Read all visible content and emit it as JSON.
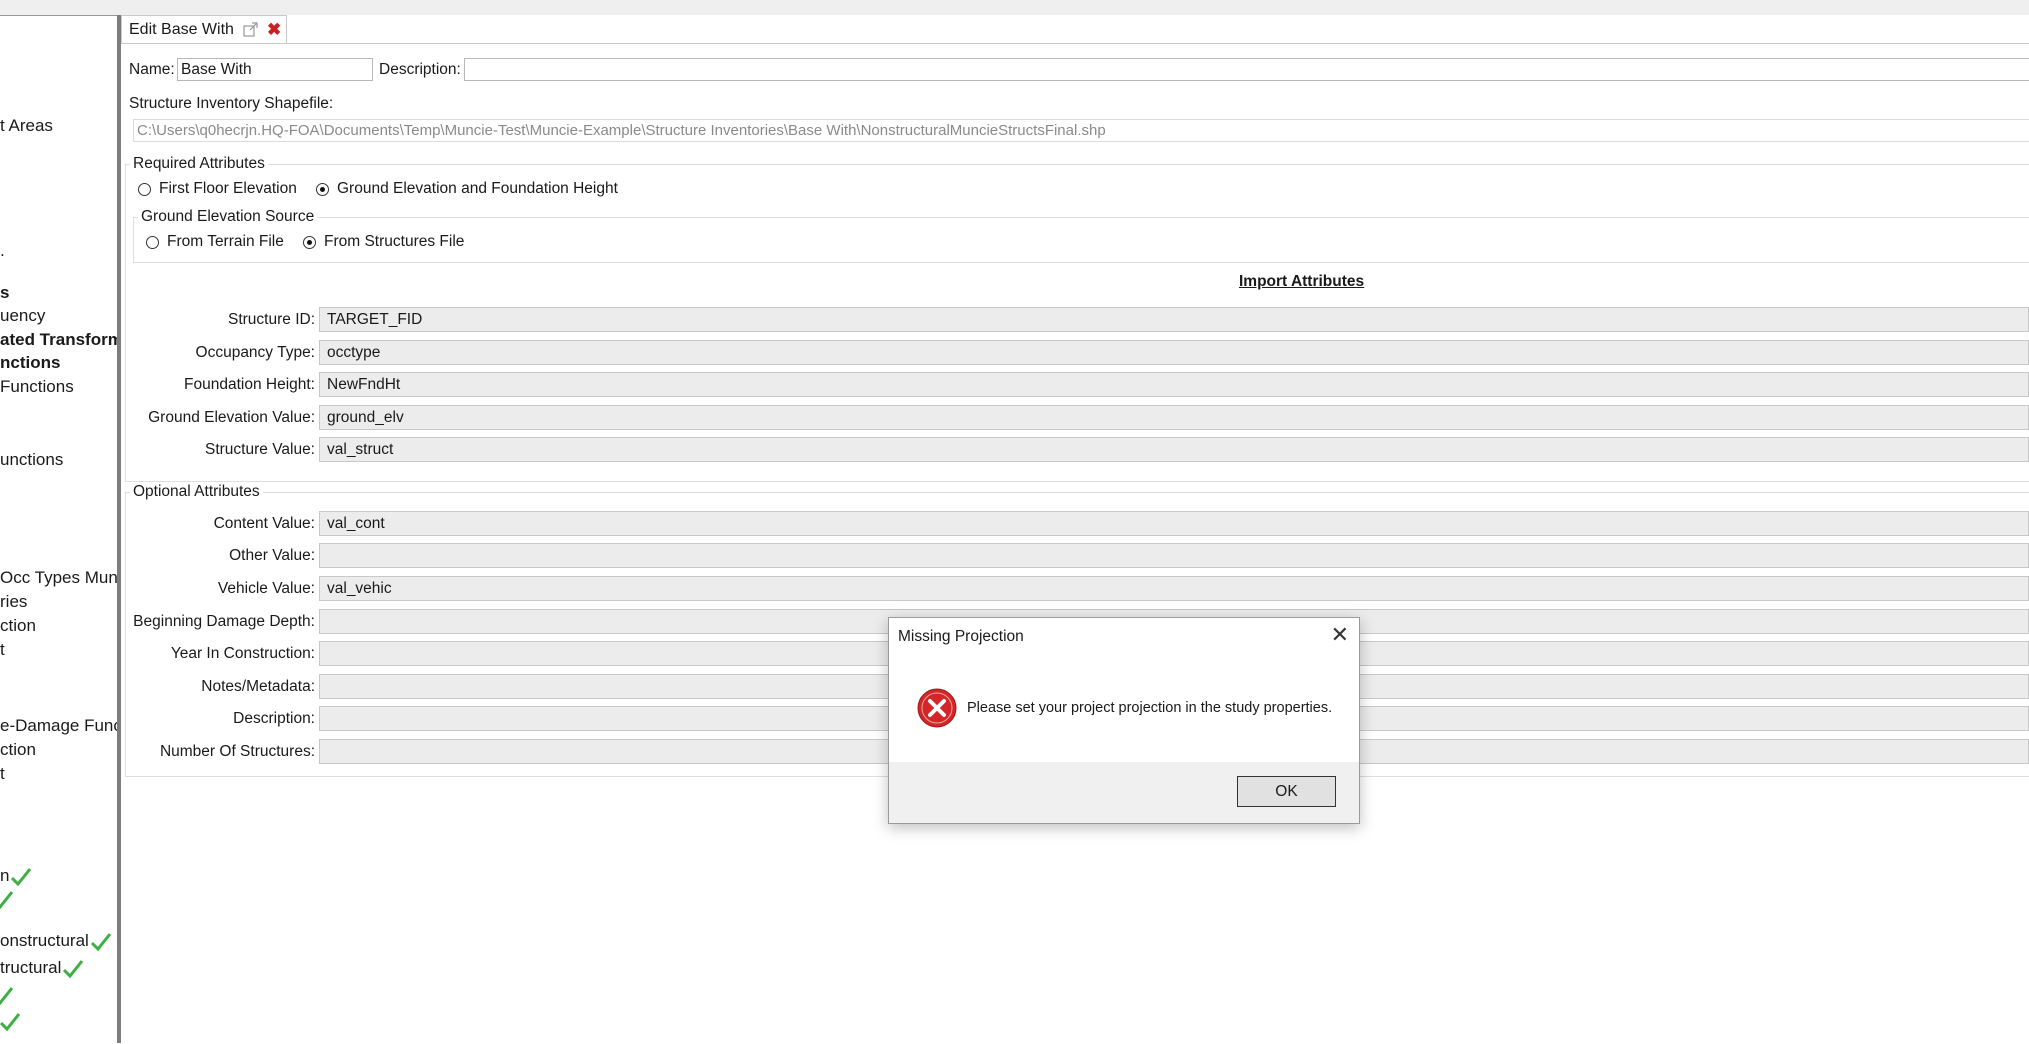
{
  "sidebar": {
    "items": [
      {
        "label": "t Areas",
        "bold": false,
        "check": false
      },
      {
        "label": ".",
        "bold": false,
        "check": false
      },
      {
        "label": "s",
        "bold": true,
        "check": false
      },
      {
        "label": "uency",
        "bold": false,
        "check": false
      },
      {
        "label": "ated Transform",
        "bold": true,
        "check": false
      },
      {
        "label": "nctions",
        "bold": true,
        "check": false
      },
      {
        "label": "Functions",
        "bold": false,
        "check": false
      },
      {
        "label": "unctions",
        "bold": false,
        "check": false
      },
      {
        "label": "Occ Types Munc",
        "bold": false,
        "check": false
      },
      {
        "label": "ries",
        "bold": false,
        "check": false
      },
      {
        "label": "ction",
        "bold": false,
        "check": false
      },
      {
        "label": "t",
        "bold": false,
        "check": false
      },
      {
        "label": "e-Damage Func",
        "bold": false,
        "check": false
      },
      {
        "label": "ction",
        "bold": false,
        "check": false
      },
      {
        "label": "t",
        "bold": false,
        "check": false
      },
      {
        "label": "n",
        "bold": false,
        "check": true
      },
      {
        "label": "onstructural",
        "bold": false,
        "check": true
      },
      {
        "label": "tructural",
        "bold": false,
        "check": true
      }
    ]
  },
  "tab": {
    "title": "Edit Base With"
  },
  "form": {
    "name_label": "Name:",
    "name_value": "Base With",
    "description_label": "Description:",
    "description_value": "",
    "shapefile_label": "Structure Inventory Shapefile:",
    "shapefile_path": "C:\\Users\\q0hecrjn.HQ-FOA\\Documents\\Temp\\Muncie-Test\\Muncie-Example\\Structure Inventories\\Base With\\NonstructuralMuncieStructsFinal.shp",
    "required_title": "Required Attributes",
    "radio_ffe": "First Floor Elevation",
    "radio_ground": "Ground Elevation and Foundation Height",
    "ground_source_title": "Ground Elevation Source",
    "radio_terrain": "From Terrain File",
    "radio_structures": "From Structures File",
    "import_attributes": "Import Attributes",
    "required_fields": [
      {
        "label": "Structure ID:",
        "value": "TARGET_FID"
      },
      {
        "label": "Occupancy Type:",
        "value": "occtype"
      },
      {
        "label": "Foundation Height:",
        "value": "NewFndHt"
      },
      {
        "label": "Ground Elevation Value:",
        "value": "ground_elv"
      },
      {
        "label": "Structure Value:",
        "value": "val_struct"
      }
    ],
    "optional_title": "Optional Attributes",
    "optional_fields": [
      {
        "label": "Content Value:",
        "value": "val_cont"
      },
      {
        "label": "Other Value:",
        "value": ""
      },
      {
        "label": "Vehicle Value:",
        "value": "val_vehic"
      },
      {
        "label": "Beginning Damage Depth:",
        "value": ""
      },
      {
        "label": "Year In Construction:",
        "value": ""
      },
      {
        "label": "Notes/Metadata:",
        "value": ""
      },
      {
        "label": "Description:",
        "value": ""
      },
      {
        "label": "Number Of Structures:",
        "value": ""
      }
    ]
  },
  "dialog": {
    "title": "Missing Projection",
    "message": "Please set your project projection in the study properties.",
    "ok_label": "OK",
    "icon": "error-icon"
  },
  "colors": {
    "check": "#3cb043",
    "error_red": "#d32626",
    "tab_close": "#cc1f1f"
  }
}
